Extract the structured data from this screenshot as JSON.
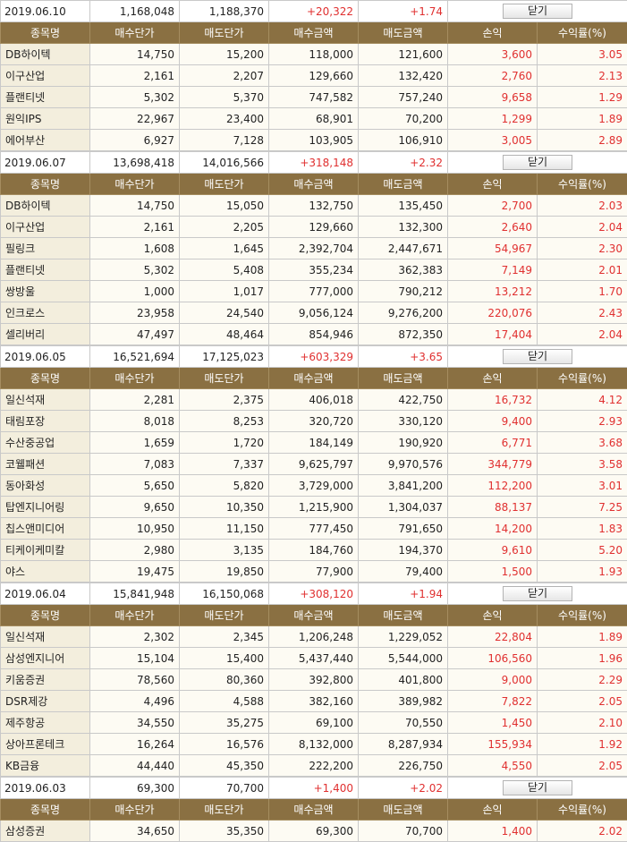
{
  "headers": [
    "종목명",
    "매수단가",
    "매도단가",
    "매수금액",
    "매도금액",
    "손익",
    "수익률(%)"
  ],
  "close_label": "닫기",
  "days": [
    {
      "date": "2019.06.10",
      "buy_total": "1,168,048",
      "sell_total": "1,188,370",
      "profit": "+20,322",
      "rate": "+1.74",
      "rows": [
        {
          "name": "DB하이텍",
          "buy_price": "14,750",
          "sell_price": "15,200",
          "buy_amount": "118,000",
          "sell_amount": "121,600",
          "profit": "3,600",
          "rate": "3.05"
        },
        {
          "name": "이구산업",
          "buy_price": "2,161",
          "sell_price": "2,207",
          "buy_amount": "129,660",
          "sell_amount": "132,420",
          "profit": "2,760",
          "rate": "2.13"
        },
        {
          "name": "플랜티넷",
          "buy_price": "5,302",
          "sell_price": "5,370",
          "buy_amount": "747,582",
          "sell_amount": "757,240",
          "profit": "9,658",
          "rate": "1.29"
        },
        {
          "name": "원익IPS",
          "buy_price": "22,967",
          "sell_price": "23,400",
          "buy_amount": "68,901",
          "sell_amount": "70,200",
          "profit": "1,299",
          "rate": "1.89"
        },
        {
          "name": "에어부산",
          "buy_price": "6,927",
          "sell_price": "7,128",
          "buy_amount": "103,905",
          "sell_amount": "106,910",
          "profit": "3,005",
          "rate": "2.89"
        }
      ]
    },
    {
      "date": "2019.06.07",
      "buy_total": "13,698,418",
      "sell_total": "14,016,566",
      "profit": "+318,148",
      "rate": "+2.32",
      "rows": [
        {
          "name": "DB하이텍",
          "buy_price": "14,750",
          "sell_price": "15,050",
          "buy_amount": "132,750",
          "sell_amount": "135,450",
          "profit": "2,700",
          "rate": "2.03"
        },
        {
          "name": "이구산업",
          "buy_price": "2,161",
          "sell_price": "2,205",
          "buy_amount": "129,660",
          "sell_amount": "132,300",
          "profit": "2,640",
          "rate": "2.04"
        },
        {
          "name": "필링크",
          "buy_price": "1,608",
          "sell_price": "1,645",
          "buy_amount": "2,392,704",
          "sell_amount": "2,447,671",
          "profit": "54,967",
          "rate": "2.30"
        },
        {
          "name": "플랜티넷",
          "buy_price": "5,302",
          "sell_price": "5,408",
          "buy_amount": "355,234",
          "sell_amount": "362,383",
          "profit": "7,149",
          "rate": "2.01"
        },
        {
          "name": "쌍방울",
          "buy_price": "1,000",
          "sell_price": "1,017",
          "buy_amount": "777,000",
          "sell_amount": "790,212",
          "profit": "13,212",
          "rate": "1.70"
        },
        {
          "name": "인크로스",
          "buy_price": "23,958",
          "sell_price": "24,540",
          "buy_amount": "9,056,124",
          "sell_amount": "9,276,200",
          "profit": "220,076",
          "rate": "2.43"
        },
        {
          "name": "셀리버리",
          "buy_price": "47,497",
          "sell_price": "48,464",
          "buy_amount": "854,946",
          "sell_amount": "872,350",
          "profit": "17,404",
          "rate": "2.04"
        }
      ]
    },
    {
      "date": "2019.06.05",
      "buy_total": "16,521,694",
      "sell_total": "17,125,023",
      "profit": "+603,329",
      "rate": "+3.65",
      "rows": [
        {
          "name": "일신석재",
          "buy_price": "2,281",
          "sell_price": "2,375",
          "buy_amount": "406,018",
          "sell_amount": "422,750",
          "profit": "16,732",
          "rate": "4.12"
        },
        {
          "name": "태림포장",
          "buy_price": "8,018",
          "sell_price": "8,253",
          "buy_amount": "320,720",
          "sell_amount": "330,120",
          "profit": "9,400",
          "rate": "2.93"
        },
        {
          "name": "수산중공업",
          "buy_price": "1,659",
          "sell_price": "1,720",
          "buy_amount": "184,149",
          "sell_amount": "190,920",
          "profit": "6,771",
          "rate": "3.68"
        },
        {
          "name": "코웰패션",
          "buy_price": "7,083",
          "sell_price": "7,337",
          "buy_amount": "9,625,797",
          "sell_amount": "9,970,576",
          "profit": "344,779",
          "rate": "3.58"
        },
        {
          "name": "동아화성",
          "buy_price": "5,650",
          "sell_price": "5,820",
          "buy_amount": "3,729,000",
          "sell_amount": "3,841,200",
          "profit": "112,200",
          "rate": "3.01"
        },
        {
          "name": "탑엔지니어링",
          "buy_price": "9,650",
          "sell_price": "10,350",
          "buy_amount": "1,215,900",
          "sell_amount": "1,304,037",
          "profit": "88,137",
          "rate": "7.25"
        },
        {
          "name": "칩스앤미디어",
          "buy_price": "10,950",
          "sell_price": "11,150",
          "buy_amount": "777,450",
          "sell_amount": "791,650",
          "profit": "14,200",
          "rate": "1.83"
        },
        {
          "name": "티케이케미칼",
          "buy_price": "2,980",
          "sell_price": "3,135",
          "buy_amount": "184,760",
          "sell_amount": "194,370",
          "profit": "9,610",
          "rate": "5.20"
        },
        {
          "name": "야스",
          "buy_price": "19,475",
          "sell_price": "19,850",
          "buy_amount": "77,900",
          "sell_amount": "79,400",
          "profit": "1,500",
          "rate": "1.93"
        }
      ]
    },
    {
      "date": "2019.06.04",
      "buy_total": "15,841,948",
      "sell_total": "16,150,068",
      "profit": "+308,120",
      "rate": "+1.94",
      "rows": [
        {
          "name": "일신석재",
          "buy_price": "2,302",
          "sell_price": "2,345",
          "buy_amount": "1,206,248",
          "sell_amount": "1,229,052",
          "profit": "22,804",
          "rate": "1.89"
        },
        {
          "name": "삼성엔지니어",
          "buy_price": "15,104",
          "sell_price": "15,400",
          "buy_amount": "5,437,440",
          "sell_amount": "5,544,000",
          "profit": "106,560",
          "rate": "1.96"
        },
        {
          "name": "키움증권",
          "buy_price": "78,560",
          "sell_price": "80,360",
          "buy_amount": "392,800",
          "sell_amount": "401,800",
          "profit": "9,000",
          "rate": "2.29"
        },
        {
          "name": "DSR제강",
          "buy_price": "4,496",
          "sell_price": "4,588",
          "buy_amount": "382,160",
          "sell_amount": "389,982",
          "profit": "7,822",
          "rate": "2.05"
        },
        {
          "name": "제주항공",
          "buy_price": "34,550",
          "sell_price": "35,275",
          "buy_amount": "69,100",
          "sell_amount": "70,550",
          "profit": "1,450",
          "rate": "2.10"
        },
        {
          "name": "상아프론테크",
          "buy_price": "16,264",
          "sell_price": "16,576",
          "buy_amount": "8,132,000",
          "sell_amount": "8,287,934",
          "profit": "155,934",
          "rate": "1.92"
        },
        {
          "name": "KB금융",
          "buy_price": "44,440",
          "sell_price": "45,350",
          "buy_amount": "222,200",
          "sell_amount": "226,750",
          "profit": "4,550",
          "rate": "2.05"
        }
      ]
    },
    {
      "date": "2019.06.03",
      "buy_total": "69,300",
      "sell_total": "70,700",
      "profit": "+1,400",
      "rate": "+2.02",
      "rows": [
        {
          "name": "삼성증권",
          "buy_price": "34,650",
          "sell_price": "35,350",
          "buy_amount": "69,300",
          "sell_amount": "70,700",
          "profit": "1,400",
          "rate": "2.02"
        }
      ]
    }
  ]
}
